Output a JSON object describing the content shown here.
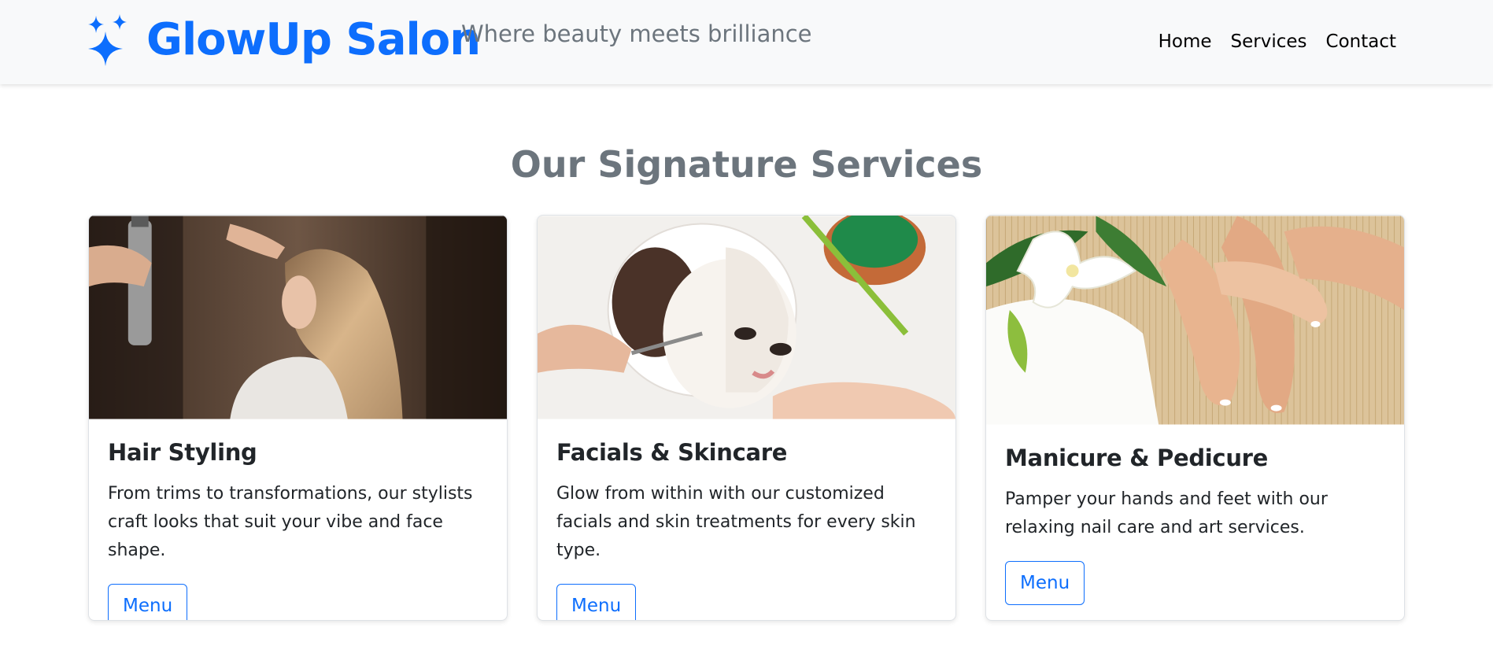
{
  "header": {
    "brand_name": "GlowUp Salon",
    "tagline": "Where beauty meets brilliance",
    "nav": [
      "Home",
      "Services",
      "Contact"
    ],
    "brand_color": "#0d6efd",
    "brand_icon": "sparkles-icon"
  },
  "section": {
    "title": "Our Signature Services"
  },
  "cards": [
    {
      "title": "Hair Styling",
      "text": "From trims to transformations, our stylists craft looks that suit your vibe and face shape.",
      "button": "Menu",
      "image": "hair-styling-photo"
    },
    {
      "title": "Facials & Skincare",
      "text": "Glow from within with our customized facials and skin treatments for every skin type.",
      "button": "Menu",
      "image": "facial-photo"
    },
    {
      "title": "Manicure & Pedicure",
      "text": "Pamper your hands and feet with our relaxing nail care and art services.",
      "button": "Menu",
      "image": "manicure-photo"
    }
  ]
}
